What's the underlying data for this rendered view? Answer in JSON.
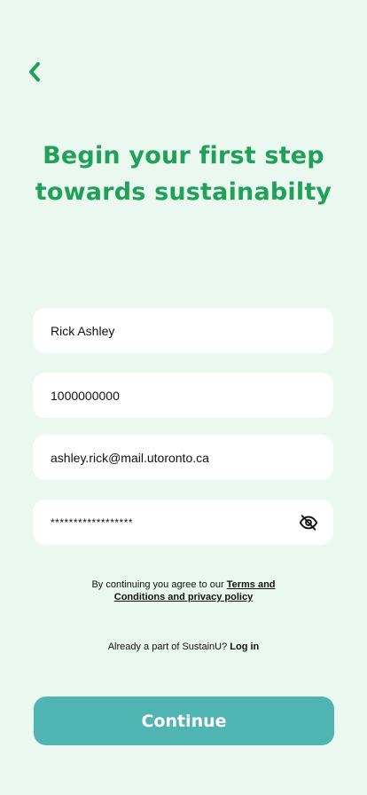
{
  "header": {
    "back_icon": "chevron-left-icon",
    "title_line1": "Begin your first step",
    "title_line2": "towards sustainabilty"
  },
  "form": {
    "name_value": "Rick Ashley",
    "phone_value": "1000000000",
    "email_value": "ashley.rick@mail.utoronto.ca",
    "password_value": "******************",
    "password_toggle_icon": "eye-off-icon"
  },
  "terms": {
    "prefix": "By continuing you agree to our ",
    "link_part1": "Terms and",
    "link_part2": "Conditions and privacy policy"
  },
  "login": {
    "prefix": "Already a part of SustainU? ",
    "link": "Log in"
  },
  "continue_label": "Continue",
  "colors": {
    "background": "#EAF8EF",
    "accent_green": "#21A05A",
    "button_teal": "#4FB4B2",
    "field_bg": "#FFFFFF"
  }
}
